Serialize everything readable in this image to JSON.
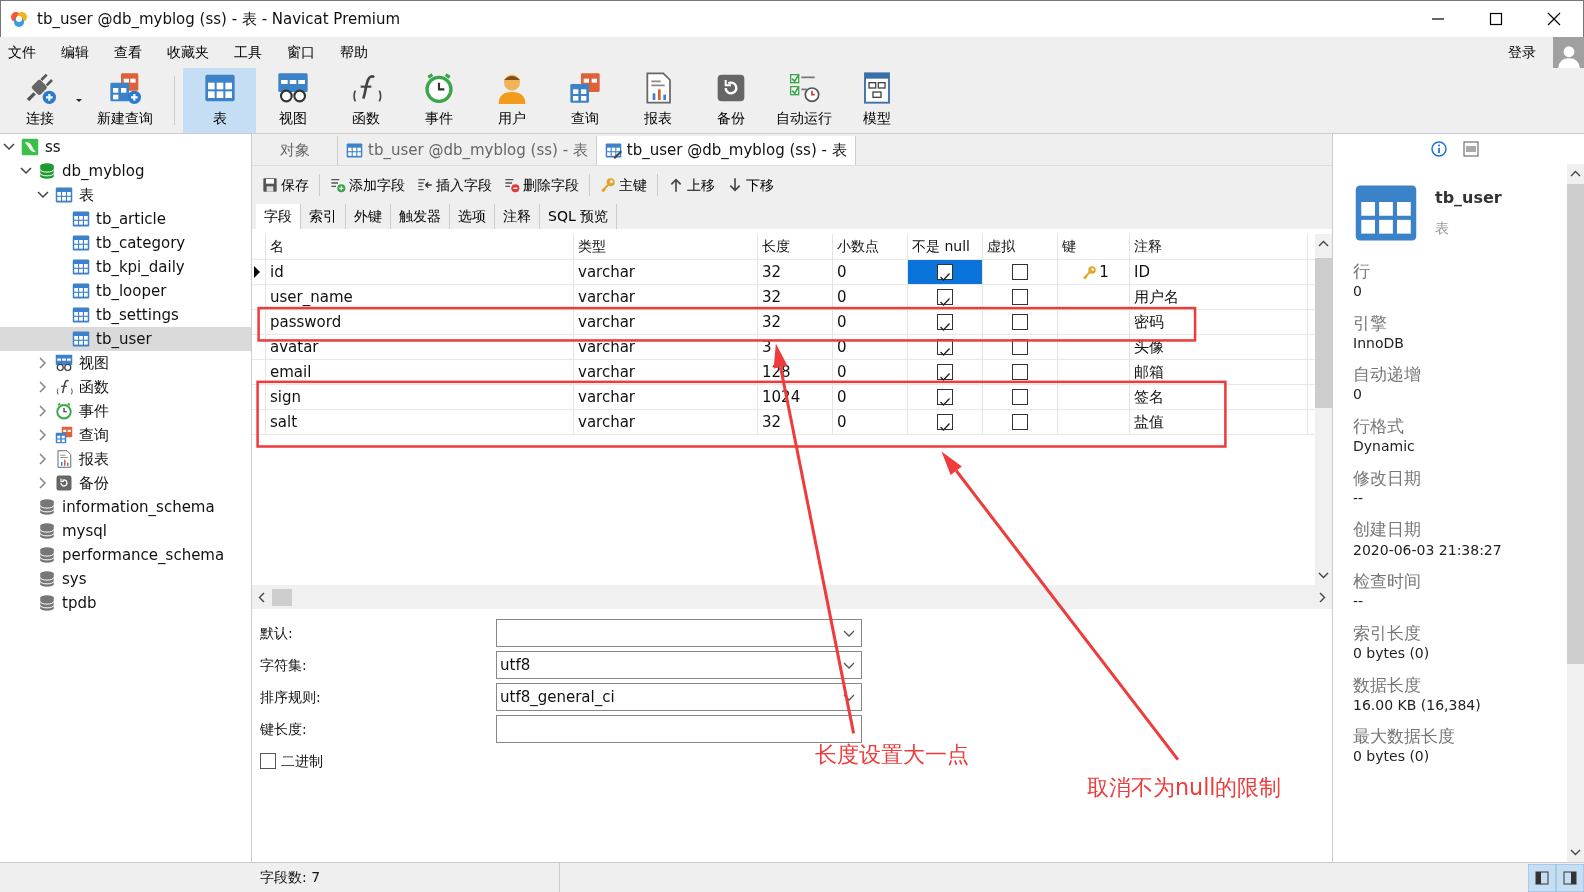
{
  "window": {
    "title": "tb_user @db_myblog (ss) - 表 - Navicat Premium"
  },
  "menu": [
    "文件",
    "编辑",
    "查看",
    "收藏夹",
    "工具",
    "窗口",
    "帮助"
  ],
  "login": "登录",
  "toolbar": [
    {
      "label": "连接",
      "kind": "connect",
      "selected": false,
      "dropdown": true
    },
    {
      "label": "新建查询",
      "kind": "newquery",
      "selected": false,
      "dropdown": false
    },
    {
      "label": "表",
      "kind": "table",
      "selected": true,
      "dropdown": false
    },
    {
      "label": "视图",
      "kind": "view",
      "selected": false,
      "dropdown": false
    },
    {
      "label": "函数",
      "kind": "func",
      "selected": false,
      "dropdown": false
    },
    {
      "label": "事件",
      "kind": "event",
      "selected": false,
      "dropdown": false
    },
    {
      "label": "用户",
      "kind": "user",
      "selected": false,
      "dropdown": false
    },
    {
      "label": "查询",
      "kind": "query",
      "selected": false,
      "dropdown": false
    },
    {
      "label": "报表",
      "kind": "report",
      "selected": false,
      "dropdown": false
    },
    {
      "label": "备份",
      "kind": "backup",
      "selected": false,
      "dropdown": false
    },
    {
      "label": "自动运行",
      "kind": "auto",
      "selected": false,
      "dropdown": false
    },
    {
      "label": "模型",
      "kind": "model",
      "selected": false,
      "dropdown": false
    }
  ],
  "sidebar": {
    "items": [
      {
        "label": "ss",
        "kind": "server",
        "expanded": true,
        "selected": false,
        "children": [
          {
            "label": "db_myblog",
            "kind": "database",
            "open": true,
            "expanded": true,
            "selected": false,
            "children": [
              {
                "label": "表",
                "kind": "table",
                "expanded": true,
                "selected": false,
                "children": [
                  {
                    "label": "tb_article",
                    "kind": "table",
                    "selected": false
                  },
                  {
                    "label": "tb_category",
                    "kind": "table",
                    "selected": false
                  },
                  {
                    "label": "tb_kpi_daily",
                    "kind": "table",
                    "selected": false
                  },
                  {
                    "label": "tb_looper",
                    "kind": "table",
                    "selected": false
                  },
                  {
                    "label": "tb_settings",
                    "kind": "table",
                    "selected": false
                  },
                  {
                    "label": "tb_user",
                    "kind": "table",
                    "selected": true
                  }
                ]
              },
              {
                "label": "视图",
                "kind": "view",
                "expanded": false,
                "selected": false
              },
              {
                "label": "函数",
                "kind": "func",
                "expanded": false,
                "selected": false
              },
              {
                "label": "事件",
                "kind": "event",
                "expanded": false,
                "selected": false
              },
              {
                "label": "查询",
                "kind": "query",
                "expanded": false,
                "selected": false
              },
              {
                "label": "报表",
                "kind": "report",
                "expanded": false,
                "selected": false
              },
              {
                "label": "备份",
                "kind": "backup",
                "expanded": false,
                "selected": false
              }
            ]
          },
          {
            "label": "information_schema",
            "kind": "database",
            "open": false,
            "selected": false
          },
          {
            "label": "mysql",
            "kind": "database",
            "open": false,
            "selected": false
          },
          {
            "label": "performance_schema",
            "kind": "database",
            "open": false,
            "selected": false
          },
          {
            "label": "sys",
            "kind": "database",
            "open": false,
            "selected": false
          },
          {
            "label": "tpdb",
            "kind": "database",
            "open": false,
            "selected": false
          }
        ]
      }
    ]
  },
  "tabs": [
    {
      "label": "对象",
      "kind": "objects",
      "selected": false
    },
    {
      "label": "tb_user @db_myblog (ss) - 表",
      "kind": "table",
      "selected": false
    },
    {
      "label": "tb_user @db_myblog (ss) - 表",
      "kind": "design",
      "selected": true
    }
  ],
  "design_toolbar": [
    {
      "label": "保存",
      "kind": "save"
    },
    {
      "label": "添加字段",
      "kind": "add"
    },
    {
      "label": "插入字段",
      "kind": "insert"
    },
    {
      "label": "删除字段",
      "kind": "delete"
    },
    {
      "label": "主键",
      "kind": "key"
    },
    {
      "label": "上移",
      "kind": "up"
    },
    {
      "label": "下移",
      "kind": "down"
    }
  ],
  "subtabs": [
    {
      "label": "字段",
      "selected": true
    },
    {
      "label": "索引",
      "selected": false
    },
    {
      "label": "外键",
      "selected": false
    },
    {
      "label": "触发器",
      "selected": false
    },
    {
      "label": "选项",
      "selected": false
    },
    {
      "label": "注释",
      "selected": false
    },
    {
      "label": "SQL 预览",
      "selected": false
    }
  ],
  "fields": {
    "columns": [
      "名",
      "类型",
      "长度",
      "小数点",
      "不是 null",
      "虚拟",
      "键",
      "注释"
    ],
    "rows": [
      {
        "name": "id",
        "type": "varchar",
        "length": "32",
        "decimal": "0",
        "not_null": true,
        "virtual": false,
        "key": "1",
        "comment": "ID",
        "current": true
      },
      {
        "name": "user_name",
        "type": "varchar",
        "length": "32",
        "decimal": "0",
        "not_null": true,
        "virtual": false,
        "comment": "用户名",
        "current": false
      },
      {
        "name": "password",
        "type": "varchar",
        "length": "32",
        "decimal": "0",
        "not_null": true,
        "virtual": false,
        "comment": "密码",
        "current": false
      },
      {
        "name": "avatar",
        "type": "varchar",
        "length": "3",
        "decimal": "0",
        "not_null": true,
        "virtual": false,
        "comment": "头像",
        "current": false
      },
      {
        "name": "email",
        "type": "varchar",
        "length": "128",
        "decimal": "0",
        "not_null": true,
        "virtual": false,
        "comment": "邮箱",
        "current": false
      },
      {
        "name": "sign",
        "type": "varchar",
        "length": "1024",
        "decimal": "0",
        "not_null": true,
        "virtual": false,
        "comment": "签名",
        "current": false
      },
      {
        "name": "salt",
        "type": "varchar",
        "length": "32",
        "decimal": "0",
        "not_null": true,
        "virtual": false,
        "comment": "盐值",
        "current": false
      }
    ]
  },
  "properties": [
    {
      "label": "默认:",
      "kind": "select"
    },
    {
      "label": "字符集:",
      "kind": "select",
      "value": "utf8"
    },
    {
      "label": "排序规则:",
      "kind": "select",
      "value": "utf8_general_ci"
    },
    {
      "label": "键长度:",
      "kind": "input"
    }
  ],
  "binary": {
    "label": "二进制",
    "checked": false
  },
  "status_bar": "字段数: 7",
  "info": {
    "name": "tb_user",
    "type": "表",
    "items": [
      {
        "label": "行",
        "value": "0"
      },
      {
        "label": "引擎",
        "value": "InnoDB"
      },
      {
        "label": "自动递增",
        "value": "0"
      },
      {
        "label": "行格式",
        "value": "Dynamic"
      },
      {
        "label": "修改日期",
        "value": "--"
      },
      {
        "label": "创建日期",
        "value": "2020-06-03 21:38:27"
      },
      {
        "label": "检查时间",
        "value": "--"
      },
      {
        "label": "索引长度",
        "value": "0 bytes (0)"
      },
      {
        "label": "数据长度",
        "value": "16.00 KB (16,384)"
      },
      {
        "label": "最大数据长度",
        "value": "0 bytes (0)"
      }
    ]
  },
  "annotations": [
    {
      "text": "长度设置大一点"
    },
    {
      "text": "取消不为null的限制"
    }
  ]
}
